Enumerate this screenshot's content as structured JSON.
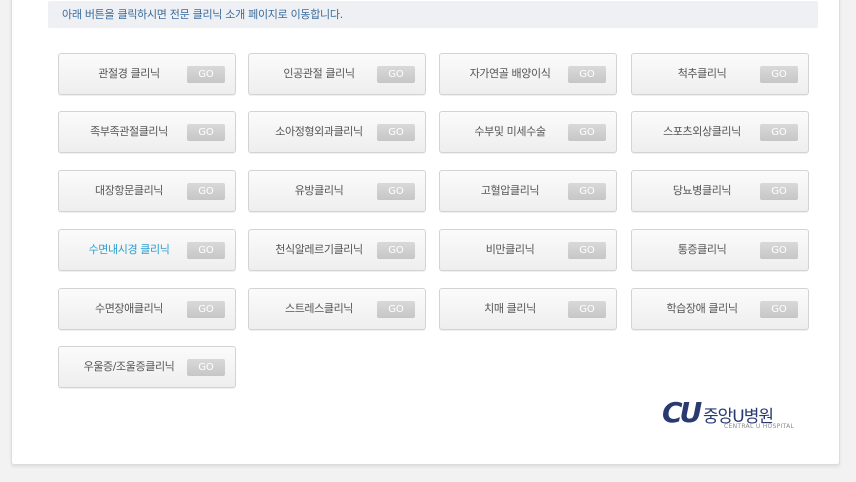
{
  "notice": "아래 버튼을 클릭하시면 전문 클리닉 소개 페이지로 이동합니다.",
  "go_label": "GO",
  "clinics": [
    {
      "label": "관절경 클리닉"
    },
    {
      "label": "인공관절 클리닉"
    },
    {
      "label": "자가연골 배양이식"
    },
    {
      "label": "척추클리닉"
    },
    {
      "label": "족부족관절클리닉"
    },
    {
      "label": "소아정형외과클리닉"
    },
    {
      "label": "수부및 미세수술"
    },
    {
      "label": "스포츠외상클리닉"
    },
    {
      "label": "대장항문클리닉"
    },
    {
      "label": "유방클리닉"
    },
    {
      "label": "고혈압클리닉"
    },
    {
      "label": "당뇨병클리닉"
    },
    {
      "label": "수면내시경 클리닉",
      "highlighted": true
    },
    {
      "label": "천식알레르기클리닉"
    },
    {
      "label": "비만클리닉"
    },
    {
      "label": "통증클리닉"
    },
    {
      "label": "수면장애클리닉"
    },
    {
      "label": "스트레스클리닉"
    },
    {
      "label": "치매 클리닉"
    },
    {
      "label": "학습장애 클리닉"
    },
    {
      "label": "우울증/조울증클리닉"
    }
  ],
  "colors": {
    "highlight": "#2a9fd0",
    "brand": "#2a3a70"
  },
  "logo": {
    "mark": "CU",
    "name": "중앙U병원",
    "sub": "CENTRAL U HOSPITAL"
  }
}
